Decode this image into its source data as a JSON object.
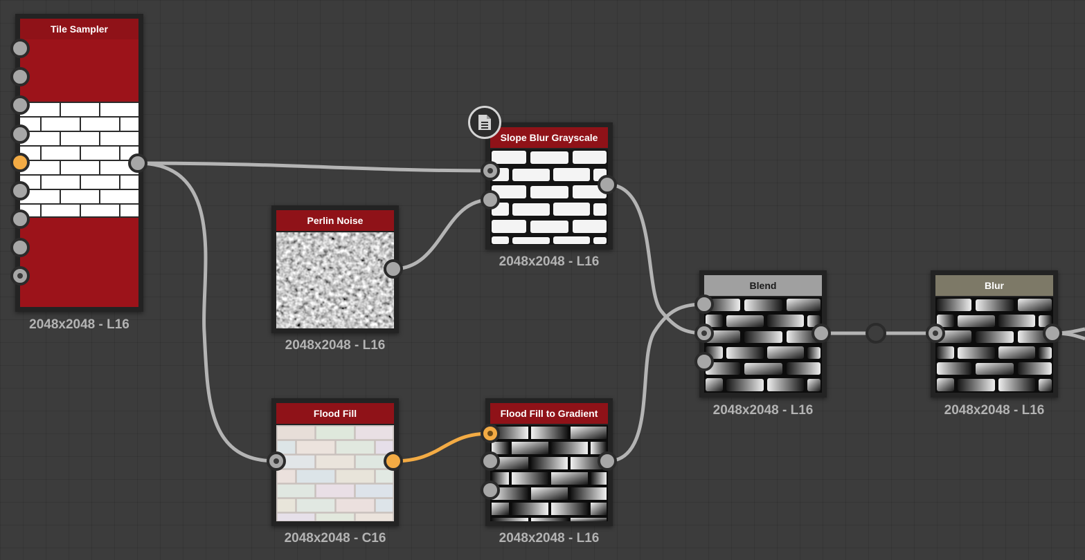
{
  "colors": {
    "background": "#3c3c3c",
    "header_red": "#8f1218",
    "header_gray": "#a0a0a0",
    "header_khaki": "#7d7967",
    "wire": "#b4b4b4",
    "wire_active": "#f3ab44",
    "port": "#a7a7a7",
    "port_active": "#f3ab44"
  },
  "nodes": {
    "tile_sampler": {
      "title": "Tile Sampler",
      "resolution": "2048x2048 - L16",
      "thumbnail": "white-brick-tiles-on-red"
    },
    "perlin_noise": {
      "title": "Perlin Noise",
      "resolution": "2048x2048 - L16",
      "thumbnail": "grayscale-noise"
    },
    "slope_blur_grayscale": {
      "title": "Slope Blur Grayscale",
      "resolution": "2048x2048 - L16",
      "thumbnail": "rough-white-bricks",
      "has_comment": true
    },
    "flood_fill": {
      "title": "Flood Fill",
      "resolution": "2048x2048 - C16",
      "thumbnail": "pastel-brick-pattern"
    },
    "flood_fill_to_gradient": {
      "title": "Flood Fill to Gradient",
      "resolution": "2048x2048 - L16",
      "thumbnail": "gradient-bricks"
    },
    "blend": {
      "title": "Blend",
      "resolution": "2048x2048 - L16",
      "thumbnail": "rough-gradient-bricks"
    },
    "blur": {
      "title": "Blur",
      "resolution": "2048x2048 - L16",
      "thumbnail": "rough-gradient-bricks"
    }
  },
  "icons": {
    "comment": "comment-icon"
  }
}
